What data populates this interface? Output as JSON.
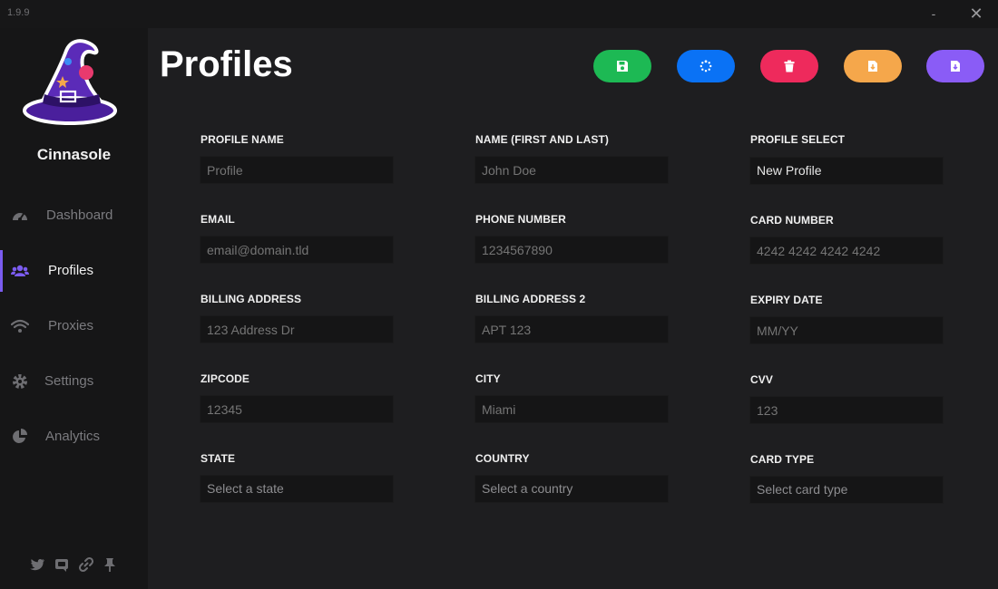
{
  "app": {
    "version": "1.9.9",
    "brand": "Cinnasole"
  },
  "window": {
    "minimize": "-",
    "close": "✕"
  },
  "sidebar": {
    "items": [
      {
        "label": "Dashboard",
        "icon": "speedometer-icon",
        "active": false
      },
      {
        "label": "Profiles",
        "icon": "users-icon",
        "active": true
      },
      {
        "label": "Proxies",
        "icon": "wifi-icon",
        "active": false
      },
      {
        "label": "Settings",
        "icon": "gear-icon",
        "active": false
      },
      {
        "label": "Analytics",
        "icon": "pie-chart-icon",
        "active": false
      }
    ],
    "social": [
      "twitter-icon",
      "discord-icon",
      "link-icon",
      "pin-icon"
    ]
  },
  "header": {
    "title": "Profiles"
  },
  "toolbar": {
    "buttons": [
      {
        "name": "save-button",
        "icon": "floppy-icon",
        "color": "#1db954"
      },
      {
        "name": "refresh-button",
        "icon": "spinner-icon",
        "color": "#0a72f5"
      },
      {
        "name": "delete-button",
        "icon": "trash-icon",
        "color": "#ee2a5c"
      },
      {
        "name": "import-button",
        "icon": "file-import-icon",
        "color": "#f5a74b"
      },
      {
        "name": "export-button",
        "icon": "file-export-icon",
        "color": "#8a5cf6"
      }
    ]
  },
  "form": {
    "profile_name": {
      "label": "PROFILE NAME",
      "placeholder": "Profile"
    },
    "full_name": {
      "label": "NAME (FIRST AND LAST)",
      "placeholder": "John Doe"
    },
    "profile_select": {
      "label": "PROFILE SELECT",
      "value": "New Profile"
    },
    "email": {
      "label": "EMAIL",
      "placeholder": "email@domain.tld"
    },
    "phone": {
      "label": "PHONE NUMBER",
      "placeholder": "1234567890"
    },
    "card_number": {
      "label": "CARD NUMBER",
      "placeholder": "4242 4242 4242 4242"
    },
    "billing_address": {
      "label": "BILLING ADDRESS",
      "placeholder": "123 Address Dr"
    },
    "billing_address_2": {
      "label": "BILLING ADDRESS 2",
      "placeholder": "APT 123"
    },
    "expiry": {
      "label": "EXPIRY DATE",
      "placeholder": "MM/YY"
    },
    "zipcode": {
      "label": "ZIPCODE",
      "placeholder": "12345"
    },
    "city": {
      "label": "CITY",
      "placeholder": "Miami"
    },
    "cvv": {
      "label": "CVV",
      "placeholder": "123"
    },
    "state": {
      "label": "STATE",
      "placeholder": "Select a state"
    },
    "country": {
      "label": "COUNTRY",
      "placeholder": "Select a country"
    },
    "card_type": {
      "label": "CARD TYPE",
      "placeholder": "Select card type"
    }
  },
  "colors": {
    "accent": "#7b5cf0",
    "sidebar_bg": "#161617",
    "main_bg": "#1e1e20",
    "field_bg": "#151516"
  }
}
